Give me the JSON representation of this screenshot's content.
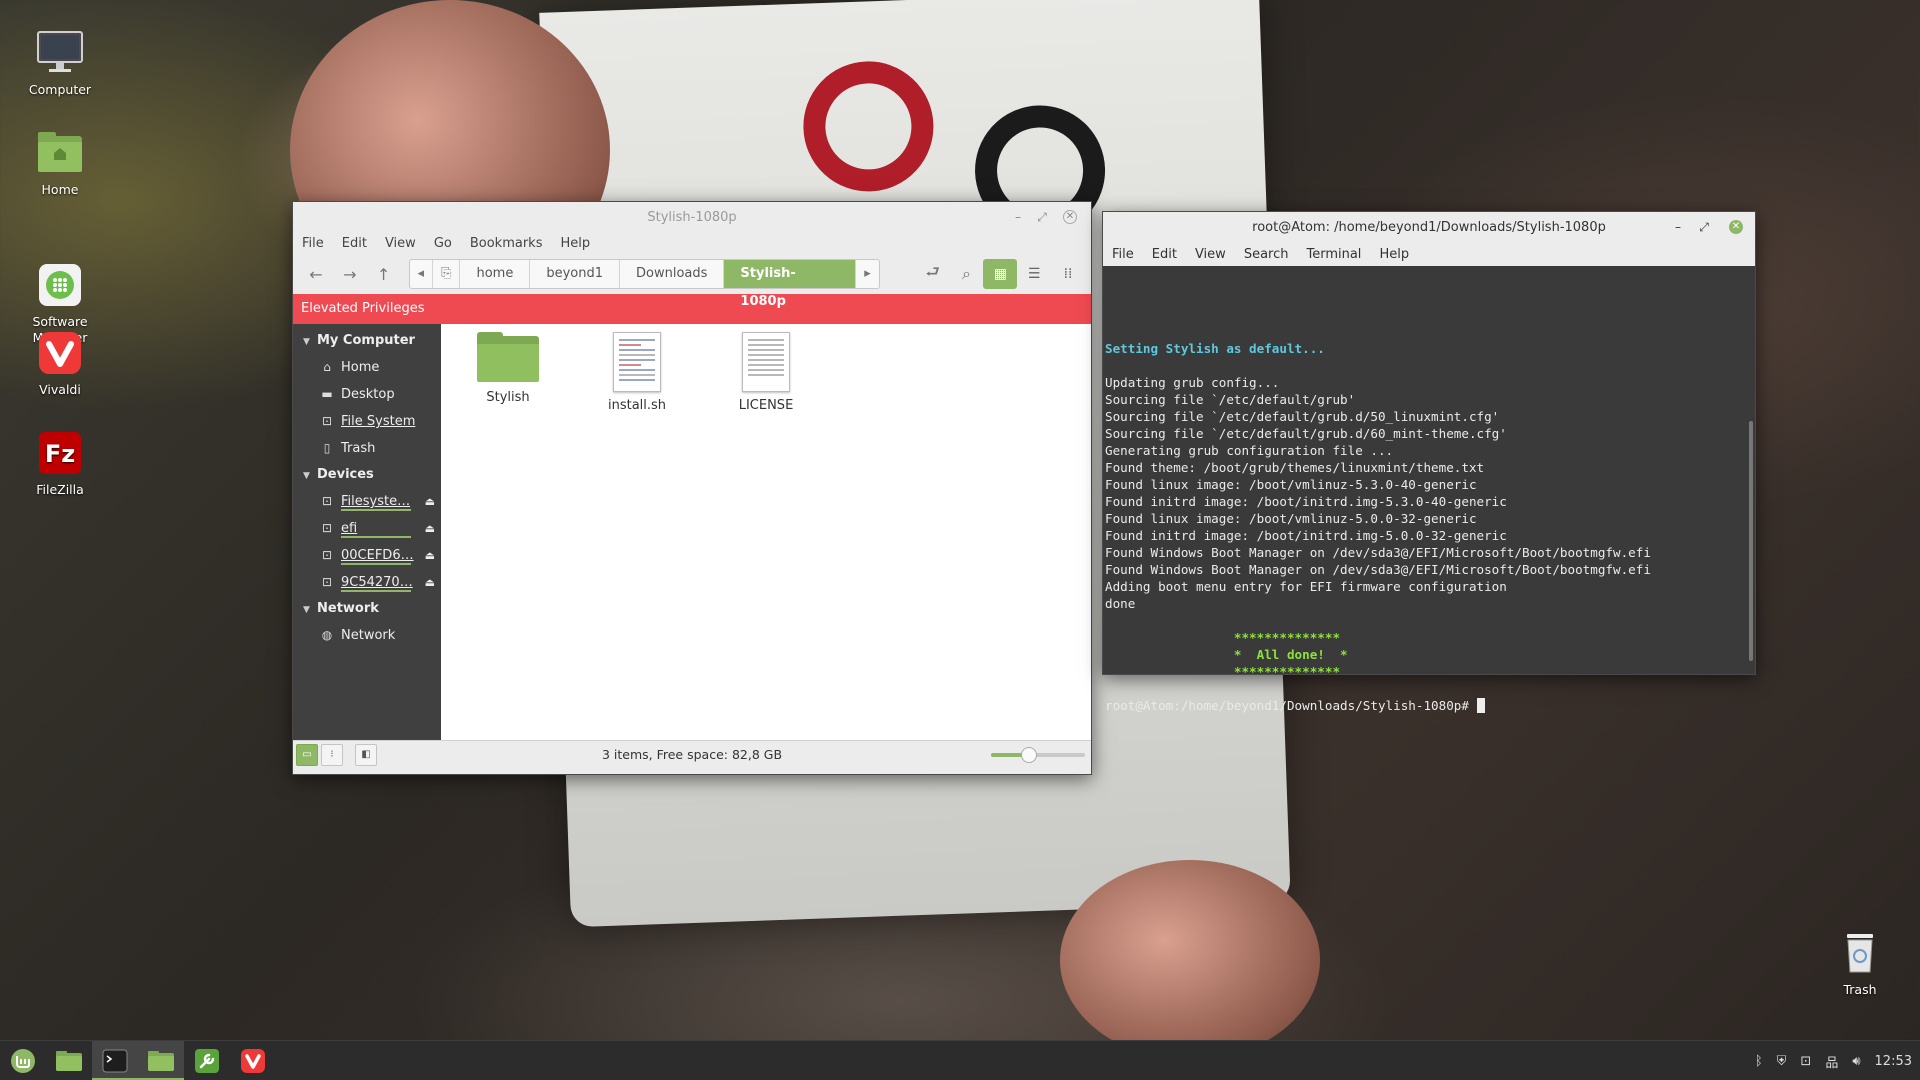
{
  "desktop": {
    "icons": [
      {
        "label": "Computer",
        "icon": "computer-icon"
      },
      {
        "label": "Home",
        "icon": "home-folder-icon"
      },
      {
        "label": "Software\nManager",
        "icon": "software-manager-icon"
      },
      {
        "label": "Vivaldi",
        "icon": "vivaldi-icon"
      },
      {
        "label": "FileZilla",
        "icon": "filezilla-icon"
      }
    ],
    "trash_label": "Trash"
  },
  "file_manager": {
    "title": "Stylish-1080p",
    "menu": [
      "File",
      "Edit",
      "View",
      "Go",
      "Bookmarks",
      "Help"
    ],
    "breadcrumbs": [
      "home",
      "beyond1",
      "Downloads",
      "Stylish-1080p"
    ],
    "active_crumb": "Stylish-1080p",
    "elevated_banner": "Elevated Privileges",
    "sidebar": {
      "sections": [
        {
          "heading": "My Computer",
          "items": [
            {
              "label": "Home",
              "icon": "home-icon"
            },
            {
              "label": "Desktop",
              "icon": "desktop-icon"
            },
            {
              "label": "File System",
              "icon": "drive-icon"
            },
            {
              "label": "Trash",
              "icon": "trash-icon"
            }
          ]
        },
        {
          "heading": "Devices",
          "items": [
            {
              "label": "Filesyste…",
              "icon": "drive-icon"
            },
            {
              "label": "efi",
              "icon": "drive-icon"
            },
            {
              "label": "00CEFD6…",
              "icon": "drive-icon"
            },
            {
              "label": "9C54270…",
              "icon": "drive-icon"
            }
          ]
        },
        {
          "heading": "Network",
          "items": [
            {
              "label": "Network",
              "icon": "network-globe-icon"
            }
          ]
        }
      ]
    },
    "files": [
      {
        "name": "Stylish",
        "type": "folder"
      },
      {
        "name": "install.sh",
        "type": "script"
      },
      {
        "name": "LICENSE",
        "type": "text"
      }
    ],
    "status": "3 items, Free space: 82,8 GB",
    "zoom_level": 0.4
  },
  "terminal": {
    "title": "root@Atom: /home/beyond1/Downloads/Stylish-1080p",
    "menu": [
      "File",
      "Edit",
      "View",
      "Search",
      "Terminal",
      "Help"
    ],
    "lines": [
      {
        "text": "",
        "style": "normal"
      },
      {
        "text": "Setting Stylish as default...",
        "style": "cyan"
      },
      {
        "text": "",
        "style": "normal"
      },
      {
        "text": "Updating grub config...",
        "style": "normal"
      },
      {
        "text": "Sourcing file `/etc/default/grub'",
        "style": "normal"
      },
      {
        "text": "Sourcing file `/etc/default/grub.d/50_linuxmint.cfg'",
        "style": "normal"
      },
      {
        "text": "Sourcing file `/etc/default/grub.d/60_mint-theme.cfg'",
        "style": "normal"
      },
      {
        "text": "Generating grub configuration file ...",
        "style": "normal"
      },
      {
        "text": "Found theme: /boot/grub/themes/linuxmint/theme.txt",
        "style": "normal"
      },
      {
        "text": "Found linux image: /boot/vmlinuz-5.3.0-40-generic",
        "style": "normal"
      },
      {
        "text": "Found initrd image: /boot/initrd.img-5.3.0-40-generic",
        "style": "normal"
      },
      {
        "text": "Found linux image: /boot/vmlinuz-5.0.0-32-generic",
        "style": "normal"
      },
      {
        "text": "Found initrd image: /boot/initrd.img-5.0.0-32-generic",
        "style": "normal"
      },
      {
        "text": "Found Windows Boot Manager on /dev/sda3@/EFI/Microsoft/Boot/bootmgfw.efi",
        "style": "normal"
      },
      {
        "text": "Found Windows Boot Manager on /dev/sda3@/EFI/Microsoft/Boot/bootmgfw.efi",
        "style": "normal"
      },
      {
        "text": "Adding boot menu entry for EFI firmware configuration",
        "style": "normal"
      },
      {
        "text": "done",
        "style": "normal"
      },
      {
        "text": "",
        "style": "normal"
      },
      {
        "text": "                 **************",
        "style": "green"
      },
      {
        "text": "                 *  All done!  *",
        "style": "green"
      },
      {
        "text": "                 **************",
        "style": "green"
      },
      {
        "text": "",
        "style": "normal"
      }
    ],
    "prompt": "root@Atom:/home/beyond1/Downloads/Stylish-1080p# "
  },
  "taskbar": {
    "apps": [
      "mint-menu-icon",
      "show-desktop-icon",
      "terminal-icon",
      "files-icon",
      "tools-icon",
      "vivaldi-icon"
    ],
    "clock": "12:53",
    "tray_icons": [
      "bluetooth-icon",
      "update-shield-icon",
      "drive-icon",
      "network-icon",
      "volume-icon"
    ]
  },
  "colors": {
    "mint_accent": "#8fb866",
    "elevated_red": "#ef4a52",
    "terminal_cyan": "#5ec8de",
    "terminal_green": "#8ee237"
  }
}
